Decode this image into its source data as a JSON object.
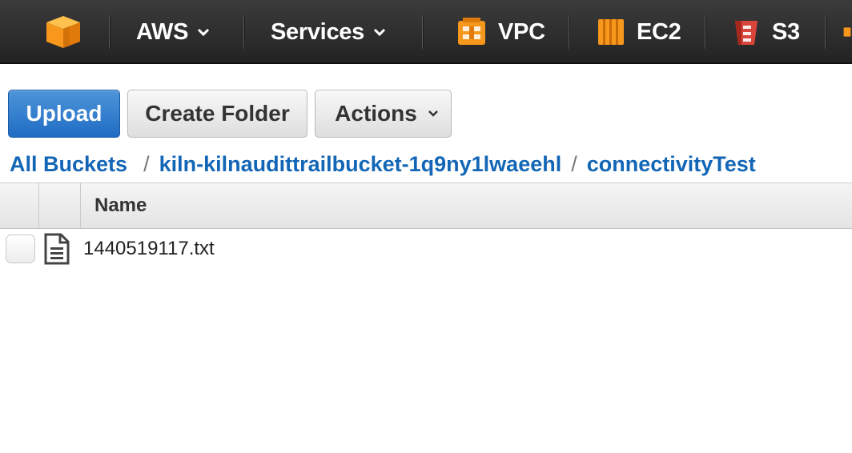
{
  "nav": {
    "aws_label": "AWS",
    "services_label": "Services",
    "vpc_label": "VPC",
    "ec2_label": "EC2",
    "s3_label": "S3"
  },
  "toolbar": {
    "upload_label": "Upload",
    "create_folder_label": "Create Folder",
    "actions_label": "Actions"
  },
  "breadcrumb": {
    "root": "All Buckets",
    "bucket": "kiln-kilnaudittrailbucket-1q9ny1lwaeehl",
    "folder": "connectivityTest",
    "separator": "/"
  },
  "table": {
    "columns": [
      "Name"
    ],
    "rows": [
      {
        "name": "1440519117.txt",
        "icon": "text-file-icon"
      }
    ]
  },
  "colors": {
    "nav_bg": "#2b2b2b",
    "primary_button": "#2671c7",
    "link": "#1366b6",
    "aws_orange": "#f7981d",
    "s3_red": "#d9453b"
  }
}
